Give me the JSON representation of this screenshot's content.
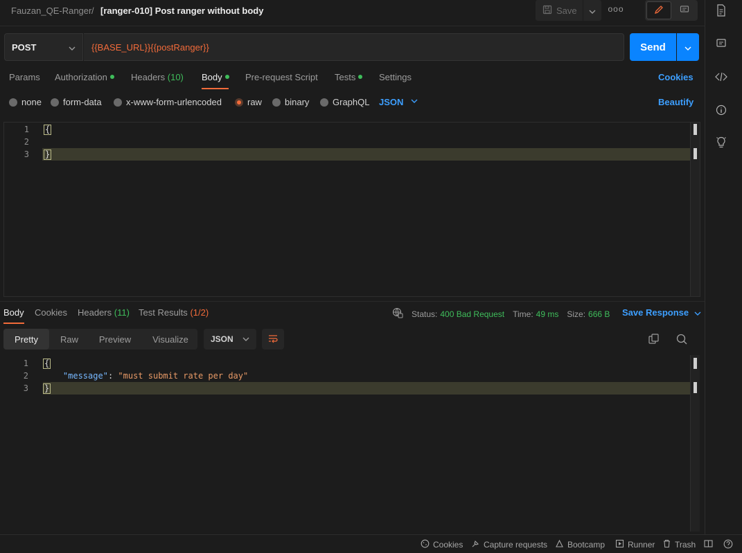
{
  "header": {
    "collection": "Fauzan_QE-Ranger",
    "separator": "/",
    "request_name": "[ranger-010] Post ranger without body",
    "save_label": "Save",
    "more_label": "ooo"
  },
  "request": {
    "method": "POST",
    "url": "{{BASE_URL}}{{postRanger}}",
    "send_label": "Send"
  },
  "tabs": {
    "params": "Params",
    "authorization": "Authorization",
    "headers": "Headers",
    "headers_count": "(10)",
    "body": "Body",
    "prerequest": "Pre-request Script",
    "tests": "Tests",
    "settings": "Settings",
    "cookies": "Cookies"
  },
  "body_types": {
    "none": "none",
    "form_data": "form-data",
    "urlencoded": "x-www-form-urlencoded",
    "raw": "raw",
    "binary": "binary",
    "graphql": "GraphQL",
    "language": "JSON",
    "beautify": "Beautify",
    "selected": "raw"
  },
  "request_body": {
    "lines": [
      {
        "num": "1",
        "text": "{"
      },
      {
        "num": "2",
        "text": ""
      },
      {
        "num": "3",
        "text": "}"
      }
    ]
  },
  "response": {
    "tabs": {
      "body": "Body",
      "cookies": "Cookies",
      "headers": "Headers",
      "headers_count": "(11)",
      "test_results": "Test Results",
      "test_count": "(1/2)"
    },
    "status_label": "Status:",
    "status_value": "400 Bad Request",
    "time_label": "Time:",
    "time_value": "49 ms",
    "size_label": "Size:",
    "size_value": "666 B",
    "save_response": "Save Response",
    "view_modes": {
      "pretty": "Pretty",
      "raw": "Raw",
      "preview": "Preview",
      "visualize": "Visualize"
    },
    "language": "JSON",
    "lines": {
      "l1_num": "1",
      "l1_text": "{",
      "l2_num": "2",
      "l2_key": "\"message\"",
      "l2_colon": ": ",
      "l2_value": "\"must submit rate per day\"",
      "l3_num": "3",
      "l3_text": "}"
    }
  },
  "footer": {
    "cookies": "Cookies",
    "capture": "Capture requests",
    "bootcamp": "Bootcamp",
    "runner": "Runner",
    "trash": "Trash"
  },
  "colors": {
    "accent": "#f26b3a",
    "primary": "#0a84ff",
    "success": "#3fbd5b",
    "link": "#3d9fff"
  }
}
